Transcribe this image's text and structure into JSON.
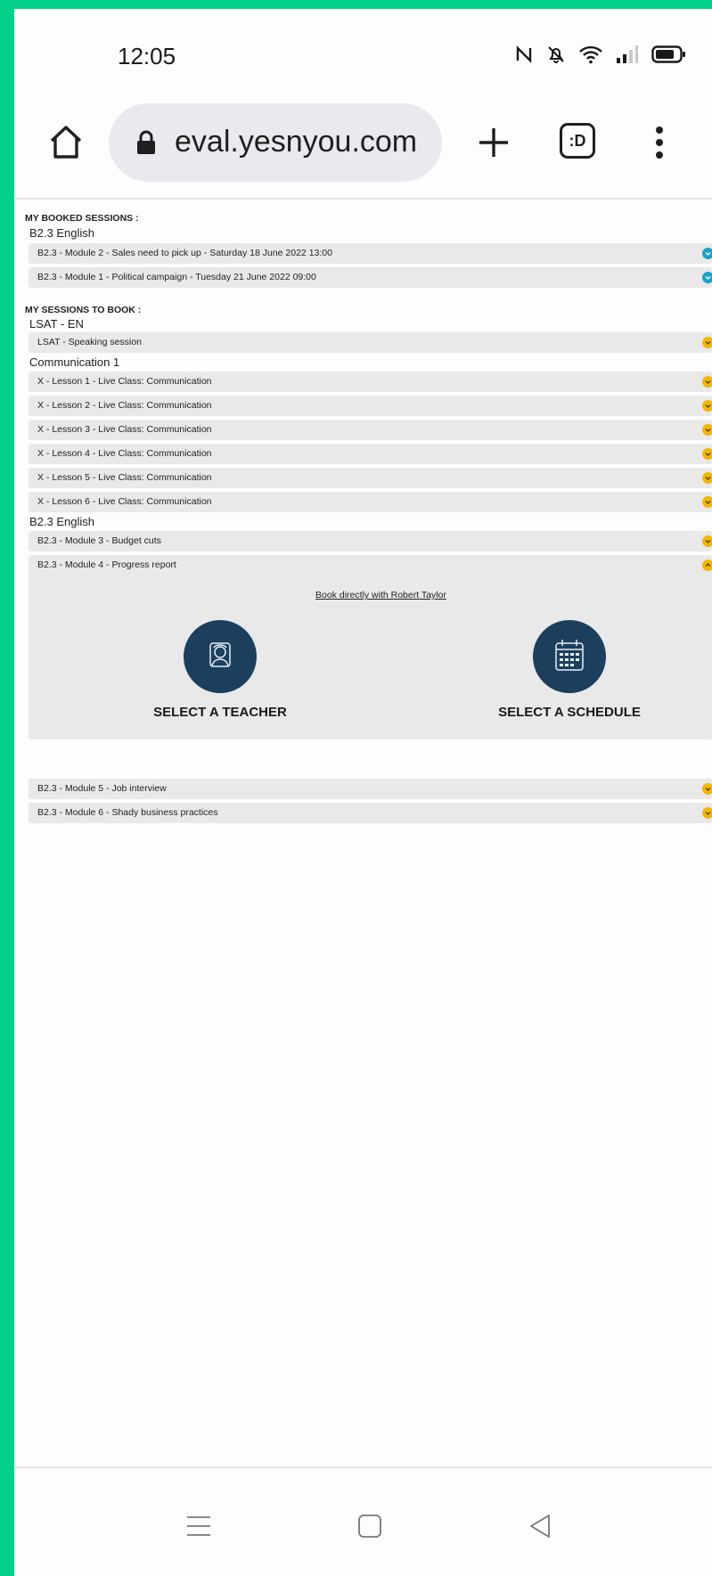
{
  "status_bar": {
    "time": "12:05",
    "icons": [
      "nfc-icon",
      "bell-off-icon",
      "wifi-icon",
      "signal-icon",
      "battery-icon"
    ]
  },
  "browser": {
    "url": "eval.yesnyou.com",
    "tabs_label": ":D"
  },
  "booked": {
    "title": "MY BOOKED SESSIONS :",
    "group": "B2.3 English",
    "sessions": [
      "B2.3 - Module 2 - Sales need to pick up - Saturday 18 June 2022   13:00",
      "B2.3 - Module 1 - Political campaign - Tuesday 21 June 2022   09:00"
    ]
  },
  "to_book": {
    "title": "MY SESSIONS TO BOOK :",
    "groups": [
      {
        "name": "LSAT - EN",
        "items": [
          "LSAT - Speaking session"
        ]
      },
      {
        "name": "Communication 1",
        "items": [
          "X - Lesson 1 - Live Class: Communication",
          "X - Lesson 2 - Live Class: Communication",
          "X - Lesson 3 - Live Class: Communication",
          "X - Lesson 4 - Live Class: Communication",
          "X - Lesson 5 - Live Class: Communication",
          "X - Lesson 6 - Live Class: Communication"
        ]
      },
      {
        "name": "B2.3 English",
        "items": [
          "B2.3 - Module 3 - Budget cuts",
          "B2.3 - Module 4 - Progress report",
          "B2.3 - Module 5 - Job interview",
          "B2.3 - Module 6 - Shady business practices"
        ]
      }
    ],
    "expanded": {
      "book_directly": "Book directly with Robert Taylor",
      "select_teacher": "SELECT A TEACHER",
      "select_schedule": "SELECT A SCHEDULE"
    }
  },
  "colors": {
    "booked_chevron": "#1aa3c8",
    "to_book_chevron": "#f2b705",
    "action_circle": "#1c3f5e",
    "frame": "#02d18a"
  }
}
